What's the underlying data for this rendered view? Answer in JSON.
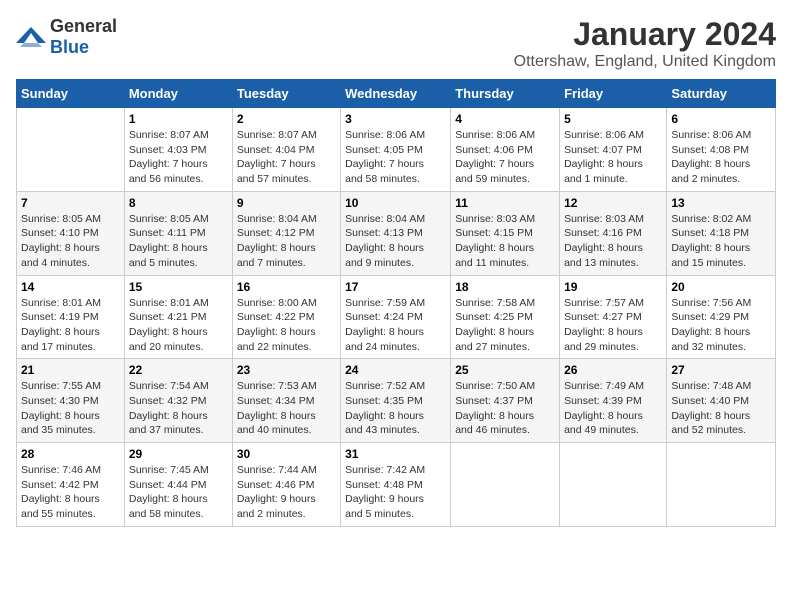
{
  "header": {
    "logo_general": "General",
    "logo_blue": "Blue",
    "month": "January 2024",
    "location": "Ottershaw, England, United Kingdom"
  },
  "weekdays": [
    "Sunday",
    "Monday",
    "Tuesday",
    "Wednesday",
    "Thursday",
    "Friday",
    "Saturday"
  ],
  "weeks": [
    [
      {
        "day": "",
        "info": ""
      },
      {
        "day": "1",
        "info": "Sunrise: 8:07 AM\nSunset: 4:03 PM\nDaylight: 7 hours\nand 56 minutes."
      },
      {
        "day": "2",
        "info": "Sunrise: 8:07 AM\nSunset: 4:04 PM\nDaylight: 7 hours\nand 57 minutes."
      },
      {
        "day": "3",
        "info": "Sunrise: 8:06 AM\nSunset: 4:05 PM\nDaylight: 7 hours\nand 58 minutes."
      },
      {
        "day": "4",
        "info": "Sunrise: 8:06 AM\nSunset: 4:06 PM\nDaylight: 7 hours\nand 59 minutes."
      },
      {
        "day": "5",
        "info": "Sunrise: 8:06 AM\nSunset: 4:07 PM\nDaylight: 8 hours\nand 1 minute."
      },
      {
        "day": "6",
        "info": "Sunrise: 8:06 AM\nSunset: 4:08 PM\nDaylight: 8 hours\nand 2 minutes."
      }
    ],
    [
      {
        "day": "7",
        "info": "Sunrise: 8:05 AM\nSunset: 4:10 PM\nDaylight: 8 hours\nand 4 minutes."
      },
      {
        "day": "8",
        "info": "Sunrise: 8:05 AM\nSunset: 4:11 PM\nDaylight: 8 hours\nand 5 minutes."
      },
      {
        "day": "9",
        "info": "Sunrise: 8:04 AM\nSunset: 4:12 PM\nDaylight: 8 hours\nand 7 minutes."
      },
      {
        "day": "10",
        "info": "Sunrise: 8:04 AM\nSunset: 4:13 PM\nDaylight: 8 hours\nand 9 minutes."
      },
      {
        "day": "11",
        "info": "Sunrise: 8:03 AM\nSunset: 4:15 PM\nDaylight: 8 hours\nand 11 minutes."
      },
      {
        "day": "12",
        "info": "Sunrise: 8:03 AM\nSunset: 4:16 PM\nDaylight: 8 hours\nand 13 minutes."
      },
      {
        "day": "13",
        "info": "Sunrise: 8:02 AM\nSunset: 4:18 PM\nDaylight: 8 hours\nand 15 minutes."
      }
    ],
    [
      {
        "day": "14",
        "info": "Sunrise: 8:01 AM\nSunset: 4:19 PM\nDaylight: 8 hours\nand 17 minutes."
      },
      {
        "day": "15",
        "info": "Sunrise: 8:01 AM\nSunset: 4:21 PM\nDaylight: 8 hours\nand 20 minutes."
      },
      {
        "day": "16",
        "info": "Sunrise: 8:00 AM\nSunset: 4:22 PM\nDaylight: 8 hours\nand 22 minutes."
      },
      {
        "day": "17",
        "info": "Sunrise: 7:59 AM\nSunset: 4:24 PM\nDaylight: 8 hours\nand 24 minutes."
      },
      {
        "day": "18",
        "info": "Sunrise: 7:58 AM\nSunset: 4:25 PM\nDaylight: 8 hours\nand 27 minutes."
      },
      {
        "day": "19",
        "info": "Sunrise: 7:57 AM\nSunset: 4:27 PM\nDaylight: 8 hours\nand 29 minutes."
      },
      {
        "day": "20",
        "info": "Sunrise: 7:56 AM\nSunset: 4:29 PM\nDaylight: 8 hours\nand 32 minutes."
      }
    ],
    [
      {
        "day": "21",
        "info": "Sunrise: 7:55 AM\nSunset: 4:30 PM\nDaylight: 8 hours\nand 35 minutes."
      },
      {
        "day": "22",
        "info": "Sunrise: 7:54 AM\nSunset: 4:32 PM\nDaylight: 8 hours\nand 37 minutes."
      },
      {
        "day": "23",
        "info": "Sunrise: 7:53 AM\nSunset: 4:34 PM\nDaylight: 8 hours\nand 40 minutes."
      },
      {
        "day": "24",
        "info": "Sunrise: 7:52 AM\nSunset: 4:35 PM\nDaylight: 8 hours\nand 43 minutes."
      },
      {
        "day": "25",
        "info": "Sunrise: 7:50 AM\nSunset: 4:37 PM\nDaylight: 8 hours\nand 46 minutes."
      },
      {
        "day": "26",
        "info": "Sunrise: 7:49 AM\nSunset: 4:39 PM\nDaylight: 8 hours\nand 49 minutes."
      },
      {
        "day": "27",
        "info": "Sunrise: 7:48 AM\nSunset: 4:40 PM\nDaylight: 8 hours\nand 52 minutes."
      }
    ],
    [
      {
        "day": "28",
        "info": "Sunrise: 7:46 AM\nSunset: 4:42 PM\nDaylight: 8 hours\nand 55 minutes."
      },
      {
        "day": "29",
        "info": "Sunrise: 7:45 AM\nSunset: 4:44 PM\nDaylight: 8 hours\nand 58 minutes."
      },
      {
        "day": "30",
        "info": "Sunrise: 7:44 AM\nSunset: 4:46 PM\nDaylight: 9 hours\nand 2 minutes."
      },
      {
        "day": "31",
        "info": "Sunrise: 7:42 AM\nSunset: 4:48 PM\nDaylight: 9 hours\nand 5 minutes."
      },
      {
        "day": "",
        "info": ""
      },
      {
        "day": "",
        "info": ""
      },
      {
        "day": "",
        "info": ""
      }
    ]
  ]
}
